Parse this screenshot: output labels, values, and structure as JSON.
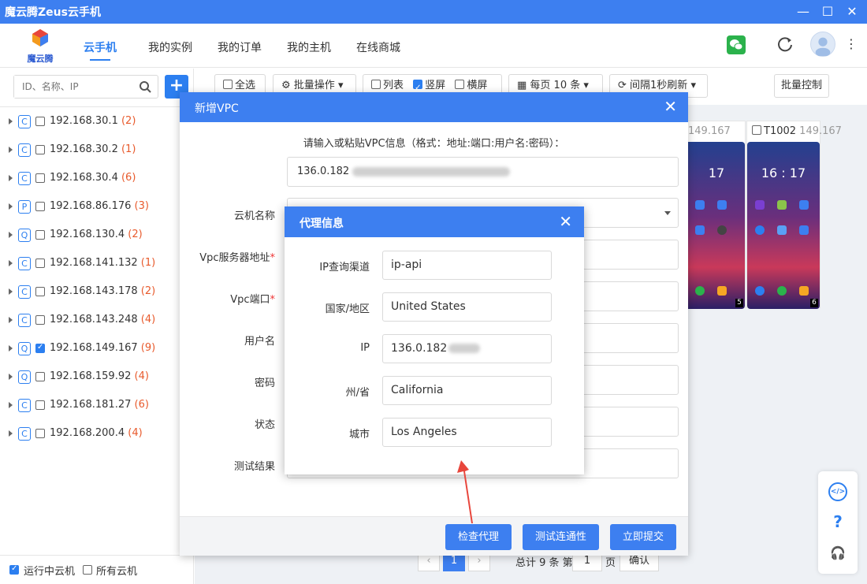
{
  "app": {
    "title": "魔云腾Zeus云手机",
    "logo_text": "魔云腾"
  },
  "nav": {
    "tabs": [
      "云手机",
      "我的实例",
      "我的订单",
      "我的主机",
      "在线商城"
    ],
    "active_tab": "云手机"
  },
  "sidebar": {
    "search_placeholder": "ID、名称、IP",
    "hosts": [
      {
        "type": "C",
        "ip": "192.168.30.1",
        "count": "(2)",
        "checked": false
      },
      {
        "type": "C",
        "ip": "192.168.30.2",
        "count": "(1)",
        "checked": false
      },
      {
        "type": "C",
        "ip": "192.168.30.4",
        "count": "(6)",
        "checked": false
      },
      {
        "type": "P",
        "ip": "192.168.86.176",
        "count": "(3)",
        "checked": false
      },
      {
        "type": "Q",
        "ip": "192.168.130.4",
        "count": "(2)",
        "checked": false
      },
      {
        "type": "C",
        "ip": "192.168.141.132",
        "count": "(1)",
        "checked": false
      },
      {
        "type": "C",
        "ip": "192.168.143.178",
        "count": "(2)",
        "checked": false
      },
      {
        "type": "C",
        "ip": "192.168.143.248",
        "count": "(4)",
        "checked": false
      },
      {
        "type": "Q",
        "ip": "192.168.149.167",
        "count": "(9)",
        "checked": true
      },
      {
        "type": "Q",
        "ip": "192.168.159.92",
        "count": "(4)",
        "checked": false
      },
      {
        "type": "C",
        "ip": "192.168.181.27",
        "count": "(6)",
        "checked": false
      },
      {
        "type": "C",
        "ip": "192.168.200.4",
        "count": "(4)",
        "checked": false
      }
    ],
    "footer": {
      "running_label": "运行中云机",
      "all_label": "所有云机"
    }
  },
  "toolbar": {
    "select_all": "全选",
    "batch_ops": "批量操作",
    "list": "列表",
    "portrait": "竖屏",
    "landscape": "横屏",
    "per_page": "每页 10 条",
    "refresh_interval": "间隔1秒刷新",
    "batch_control": "批量控制"
  },
  "cards": [
    {
      "name": "",
      "ip": "149.167",
      "time": "17",
      "badge": "5"
    },
    {
      "name": "T1002",
      "ip": "149.167",
      "time": "16 : 17",
      "badge": "6"
    }
  ],
  "pagination": {
    "current": "1",
    "total_text": "总计 9 条 第",
    "page_input": "1",
    "page_suffix": "页",
    "confirm": "确认"
  },
  "vpc_dialog": {
    "title": "新增VPC",
    "hint": "请输入或粘贴VPC信息（格式：地址:端口:用户名:密码）：",
    "paste_value": "136.0.182",
    "fields": {
      "cloud_name": "云机名称",
      "server_address": "Vpc服务器地址",
      "port": "Vpc端口",
      "username": "用户名",
      "password": "密码",
      "status": "状态",
      "test_result": "测试结果"
    },
    "buttons": {
      "check_proxy": "检查代理",
      "test_connectivity": "测试连通性",
      "submit": "立即提交"
    }
  },
  "proxy_dialog": {
    "title": "代理信息",
    "rows": [
      {
        "label": "IP查询渠道",
        "value": "ip-api"
      },
      {
        "label": "国家/地区",
        "value": "United States"
      },
      {
        "label": "IP",
        "value": "136.0.182"
      },
      {
        "label": "州/省",
        "value": "California"
      },
      {
        "label": "城市",
        "value": "Los Angeles"
      }
    ]
  },
  "colors": {
    "primary": "#3d7ff0",
    "count": "#e85a2c",
    "arrow": "#e8463c"
  }
}
